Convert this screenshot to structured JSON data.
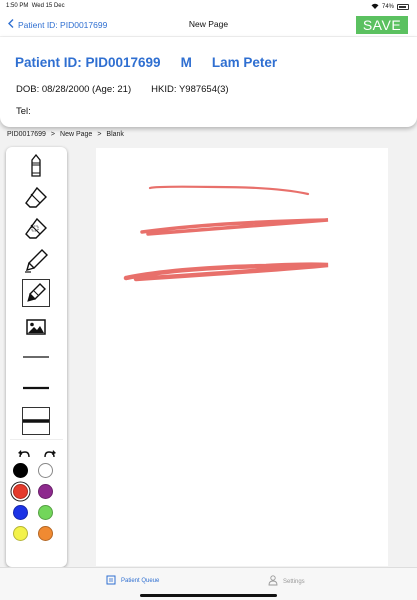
{
  "status_bar": {
    "time": "1:50 PM",
    "date": "Wed 15 Dec",
    "battery": "74%"
  },
  "nav": {
    "back_label": "Patient ID: PID0017699",
    "title": "New Page",
    "save_label": "SAVE"
  },
  "patient": {
    "id_label": "Patient ID: PID0017699",
    "sex": "M",
    "name": "Lam Peter",
    "dob": "DOB: 08/28/2000 (Age: 21)",
    "hkid": "HKID: Y987654(3)",
    "tel": "Tel:"
  },
  "breadcrumb": [
    "PID0017699",
    ">",
    "New Page",
    ">",
    "Blank"
  ],
  "tools": {
    "items": [
      "pencil-icon",
      "eraser-icon",
      "area-eraser-icon",
      "marker-icon",
      "highlighter-icon",
      "image-icon",
      "thin-line-icon",
      "medium-line-icon",
      "thick-line-icon"
    ],
    "selected": "highlighter-icon"
  },
  "colors": {
    "swatches": [
      "#000000",
      "#ffffff",
      "#e53b2c",
      "#8e2a8e",
      "#1c33e6",
      "#72d65a",
      "#f3f24a",
      "#f08a32"
    ],
    "selected": "#e53b2c"
  },
  "tab_bar": {
    "queue_label": "Patient Queue",
    "settings_label": "Settings",
    "active": "Patient Queue"
  }
}
